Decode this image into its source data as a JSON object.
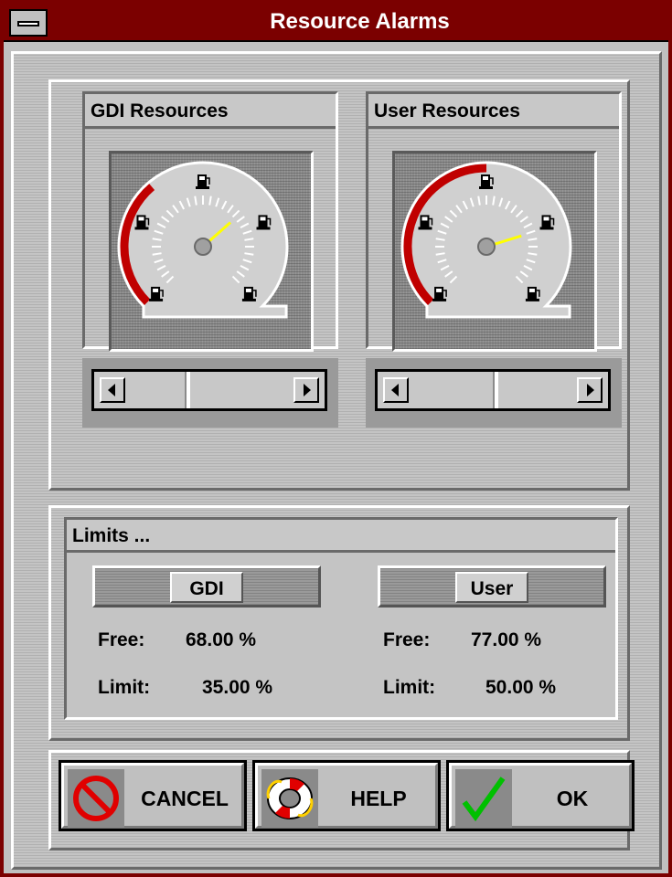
{
  "window": {
    "title": "Resource Alarms"
  },
  "gauges": [
    {
      "id": "gdi",
      "label": "GDI Resources",
      "fill_level_percent": 68,
      "alarm_limit_percent": 35,
      "slider_position_percent": 35
    },
    {
      "id": "user",
      "label": "User Resources",
      "fill_level_percent": 77,
      "alarm_limit_percent": 50,
      "slider_position_percent": 50
    }
  ],
  "limits": {
    "heading": "Limits ...",
    "gdi": {
      "badge": "GDI",
      "free_label": "Free:",
      "free_value": "68.00 %",
      "limit_label": "Limit:",
      "limit_value": "35.00 %"
    },
    "user": {
      "badge": "User",
      "free_label": "Free:",
      "free_value": "77.00 %",
      "limit_label": "Limit:",
      "limit_value": "50.00 %"
    }
  },
  "buttons": {
    "cancel": "CANCEL",
    "help": "HELP",
    "ok": "OK"
  },
  "icons": [
    "system-menu-icon",
    "fuel-pump-icon",
    "scroll-left-arrow-icon",
    "scroll-right-arrow-icon",
    "cancel-icon",
    "lifebuoy-icon",
    "checkmark-icon"
  ],
  "colors": {
    "title_bar": "#7b0000",
    "alarm_arc": "#c00000",
    "needle": "#ffff00",
    "check": "#00c000"
  }
}
